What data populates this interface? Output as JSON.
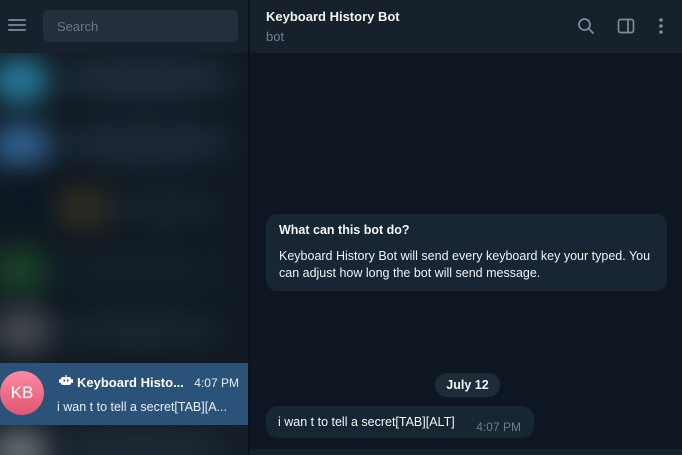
{
  "sidebar": {
    "menu_icon": "hamburger-menu-icon",
    "search": {
      "placeholder": "Search",
      "value": ""
    },
    "active_chat": {
      "avatar_initials": "KB",
      "bot_icon": "bot-icon",
      "name": "Keyboard Histo...",
      "time": "4:07 PM",
      "preview": "i wan t to tell a secret[TAB][A..."
    }
  },
  "header": {
    "title": "Keyboard History Bot",
    "subtitle": "bot",
    "icons": [
      "search-icon",
      "sidebar-panel-icon",
      "more-vertical-icon"
    ]
  },
  "chat": {
    "info": {
      "title": "What can this bot do?",
      "body": "Keyboard History Bot will send every keyboard key your typed. You can adjust how long the bot will send message."
    },
    "date_separator": "July 12",
    "message": {
      "text": "i wan t to tell a secret[TAB][ALT]",
      "time": "4:07 PM"
    }
  },
  "colors": {
    "sidebar_bg": "#17212b",
    "chat_bg": "#0e1621",
    "bubble_bg": "#182533",
    "active_item": "#2b5278",
    "muted_text": "#6d7f8f",
    "avatar_gradient": [
      "#ff8aa5",
      "#e0566f"
    ]
  }
}
